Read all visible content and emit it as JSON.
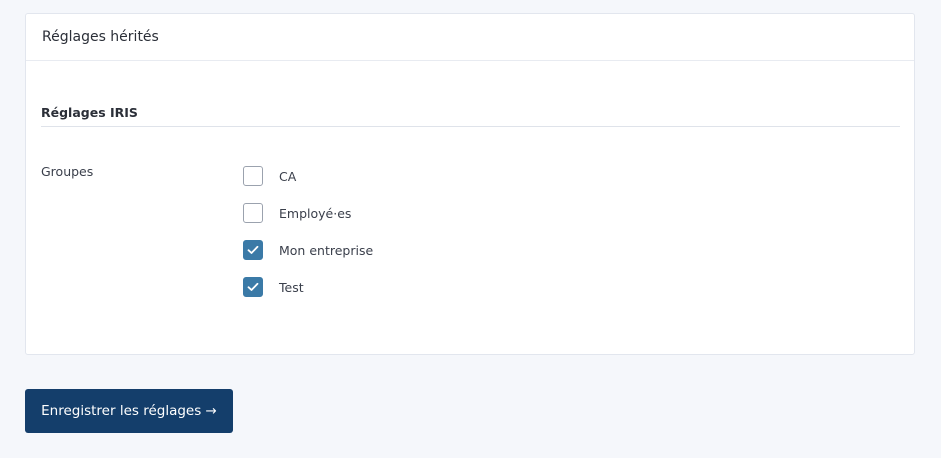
{
  "card": {
    "title": "Réglages hérités"
  },
  "section": {
    "title": "Réglages IRIS"
  },
  "groups": {
    "label": "Groupes",
    "options": [
      {
        "label": "CA",
        "checked": false
      },
      {
        "label": "Employé·es",
        "checked": false
      },
      {
        "label": "Mon entreprise",
        "checked": true
      },
      {
        "label": "Test",
        "checked": true
      }
    ]
  },
  "submit": {
    "label": "Enregistrer les réglages →"
  },
  "colors": {
    "accent": "#3b7aa7",
    "primary_button": "#143e6b",
    "background": "#f5f7fb"
  },
  "icons": {
    "checked": "check-icon"
  }
}
